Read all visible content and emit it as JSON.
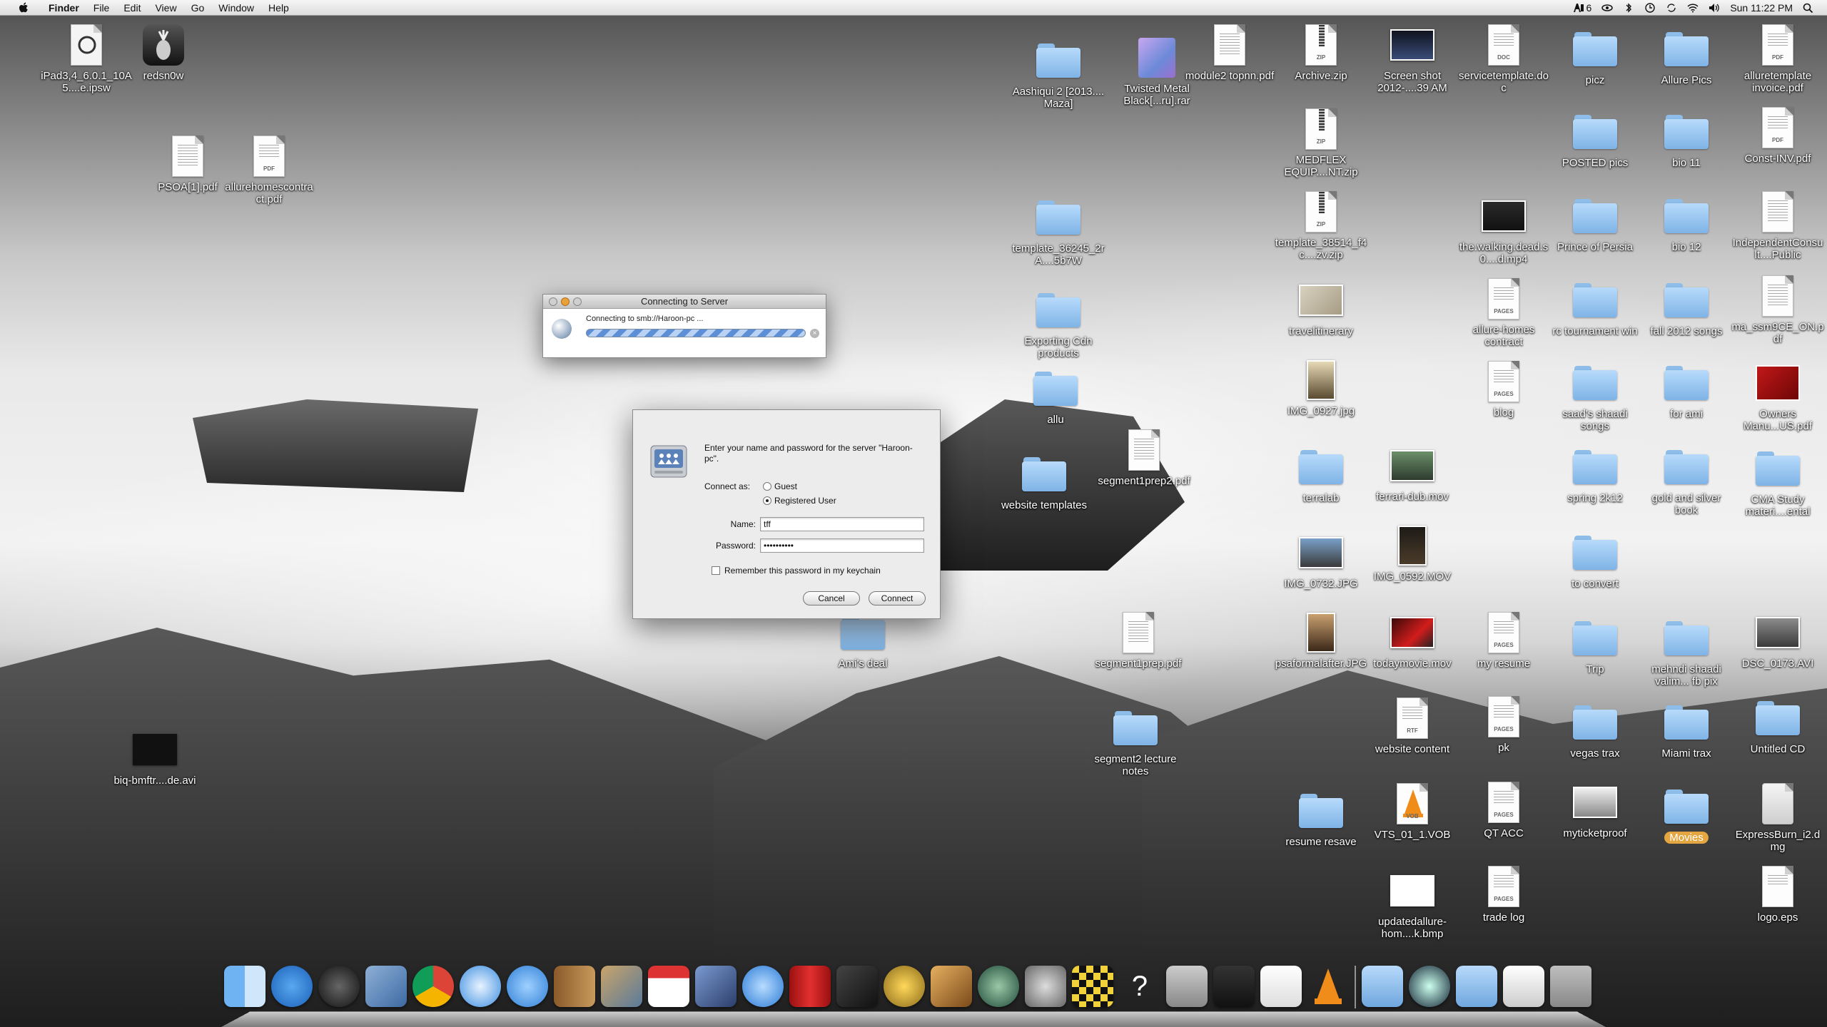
{
  "menubar": {
    "app": "Finder",
    "menus": [
      "File",
      "Edit",
      "View",
      "Go",
      "Window",
      "Help"
    ],
    "badge_count": "6",
    "clock": "Sun 11:22 PM"
  },
  "desktop_icons": [
    {
      "label": "iPad3,4_6.0.1_10A5....e.ipsw",
      "kind": "ipsw"
    },
    {
      "label": "redsn0w",
      "kind": "app"
    },
    {
      "label": "PSOA[1].pdf",
      "kind": "doc"
    },
    {
      "label": "allurehomescontract.pdf",
      "kind": "pdf"
    },
    {
      "label": "biq-bmftr....de.avi",
      "kind": "video"
    },
    {
      "label": "Aashiqui 2 [2013.... Maza]",
      "kind": "folder"
    },
    {
      "label": "Twisted Metal Black[...ru].rar",
      "kind": "rar"
    },
    {
      "label": "module2 topnn.pdf",
      "kind": "doc"
    },
    {
      "label": "Archive.zip",
      "kind": "zip"
    },
    {
      "label": "Screen shot 2012-....39 AM",
      "kind": "image"
    },
    {
      "label": "servicetemplate.doc",
      "kind": "doc"
    },
    {
      "label": "picz",
      "kind": "folder"
    },
    {
      "label": "Allure Pics",
      "kind": "folder"
    },
    {
      "label": "alluretemplate invoice.pdf",
      "kind": "pdf"
    },
    {
      "label": "MEDFLEX EQUIP....NT.zip",
      "kind": "zip"
    },
    {
      "label": "POSTED pics",
      "kind": "folder"
    },
    {
      "label": "bio 11",
      "kind": "folder"
    },
    {
      "label": "Const-INV.pdf",
      "kind": "pdf"
    },
    {
      "label": "template_36245_2rA....5b7W",
      "kind": "folder"
    },
    {
      "label": "template_38514_f4c....zv.zip",
      "kind": "zip"
    },
    {
      "label": "the.walking.dead.s0....d.mp4",
      "kind": "video"
    },
    {
      "label": "Prince of Persia",
      "kind": "folder"
    },
    {
      "label": "bio 12",
      "kind": "folder"
    },
    {
      "label": "IndependentConsult....Public",
      "kind": "doc"
    },
    {
      "label": "Exporting Cdn products",
      "kind": "folder"
    },
    {
      "label": "travelitinerary",
      "kind": "image"
    },
    {
      "label": "allure-homes contract",
      "kind": "pages"
    },
    {
      "label": "rc tournament win",
      "kind": "folder"
    },
    {
      "label": "fall 2012 songs",
      "kind": "folder"
    },
    {
      "label": "ma_ssm9CE_ON.pdf",
      "kind": "doc"
    },
    {
      "label": "allu",
      "kind": "folder"
    },
    {
      "label": "IMG_0927.jpg",
      "kind": "image"
    },
    {
      "label": "blog",
      "kind": "pages"
    },
    {
      "label": "saad's shaadi songs",
      "kind": "folder"
    },
    {
      "label": "for ami",
      "kind": "folder"
    },
    {
      "label": "Owners Manu...US.pdf",
      "kind": "pdfred"
    },
    {
      "label": "website templates",
      "kind": "folder"
    },
    {
      "label": "segment1prep2.pdf",
      "kind": "doc"
    },
    {
      "label": "terralab",
      "kind": "folder"
    },
    {
      "label": "ferrari-dub.mov",
      "kind": "video"
    },
    {
      "label": "spring 2k12",
      "kind": "folder"
    },
    {
      "label": "gold and silver book",
      "kind": "folder"
    },
    {
      "label": "CMA Study materi....ental",
      "kind": "folder"
    },
    {
      "label": "IMG_0732.JPG",
      "kind": "image"
    },
    {
      "label": "IMG_0592.MOV",
      "kind": "video"
    },
    {
      "label": "to convert",
      "kind": "folder"
    },
    {
      "label": "Ami's deal",
      "kind": "folder"
    },
    {
      "label": "segment1prep.pdf",
      "kind": "doc"
    },
    {
      "label": "psaformalafter.JPG",
      "kind": "image"
    },
    {
      "label": "todaymovie.mov",
      "kind": "video"
    },
    {
      "label": "my resume",
      "kind": "pages"
    },
    {
      "label": "Trip",
      "kind": "folder"
    },
    {
      "label": "mehndi shaadi valim... fb pix",
      "kind": "folder"
    },
    {
      "label": "DSC_0173.AVI",
      "kind": "video"
    },
    {
      "label": "segment2 lecture notes",
      "kind": "folder"
    },
    {
      "label": "website content",
      "kind": "rtf"
    },
    {
      "label": "pk",
      "kind": "pages"
    },
    {
      "label": "vegas trax",
      "kind": "folder"
    },
    {
      "label": "Miami trax",
      "kind": "folder"
    },
    {
      "label": "Untitled CD",
      "kind": "cd"
    },
    {
      "label": "resume resave",
      "kind": "folder"
    },
    {
      "label": "VTS_01_1.VOB",
      "kind": "vob"
    },
    {
      "label": "QT ACC",
      "kind": "pages"
    },
    {
      "label": "myticketproof",
      "kind": "image"
    },
    {
      "label": "Movies",
      "kind": "folder-badge"
    },
    {
      "label": "ExpressBurn_i2.dmg",
      "kind": "dmg"
    },
    {
      "label": "updatedallure-hom....k.bmp",
      "kind": "image"
    },
    {
      "label": "trade log",
      "kind": "pages"
    },
    {
      "label": "logo.eps",
      "kind": "doc"
    }
  ],
  "connecting_window": {
    "title": "Connecting to Server",
    "message": "Connecting to smb://Haroon-pc ..."
  },
  "login_dialog": {
    "prompt": "Enter your name and password for the server \"Haroon-pc\".",
    "connect_as_label": "Connect as:",
    "option_guest": "Guest",
    "option_registered": "Registered User",
    "name_label": "Name:",
    "name_value": "tff",
    "password_label": "Password:",
    "password_value": "••••••••••",
    "remember_label": "Remember this password in my keychain",
    "cancel": "Cancel",
    "connect": "Connect"
  }
}
